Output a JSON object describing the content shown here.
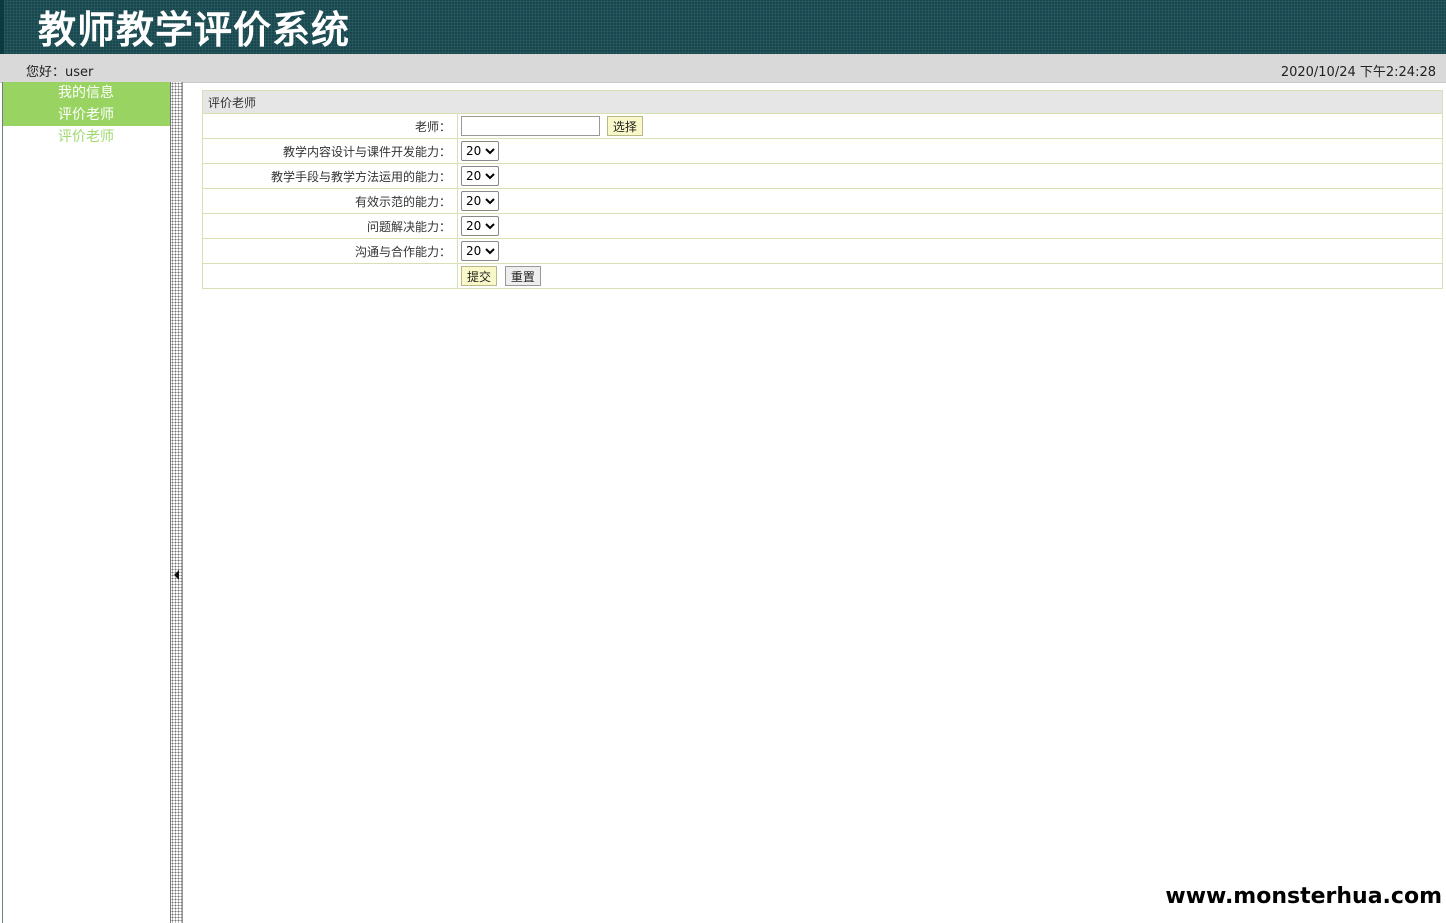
{
  "header": {
    "title": "教师教学评价系统"
  },
  "topbar": {
    "greeting": "您好：user",
    "datetime": "2020/10/24 下午2:24:28"
  },
  "sidebar": {
    "items": [
      {
        "label": "我的信息"
      },
      {
        "label": "评价老师"
      },
      {
        "label": "评价老师"
      }
    ]
  },
  "form": {
    "section_title": "评价老师",
    "teacher_label": "老师：",
    "teacher_value": "",
    "choose_button": "选择",
    "criteria": [
      {
        "label": "教学内容设计与课件开发能力：",
        "value": "20"
      },
      {
        "label": "教学手段与教学方法运用的能力：",
        "value": "20"
      },
      {
        "label": "有效示范的能力：",
        "value": "20"
      },
      {
        "label": "问题解决能力：",
        "value": "20"
      },
      {
        "label": "沟通与合作能力：",
        "value": "20"
      }
    ],
    "submit_button": "提交",
    "reset_button": "重置"
  },
  "watermark": "www.monsterhua.com",
  "colors": {
    "header_bg": "#17484f",
    "sidebar_active": "#99d463",
    "table_border": "#d6e2b5",
    "button_yellow": "#f9f8c8"
  }
}
